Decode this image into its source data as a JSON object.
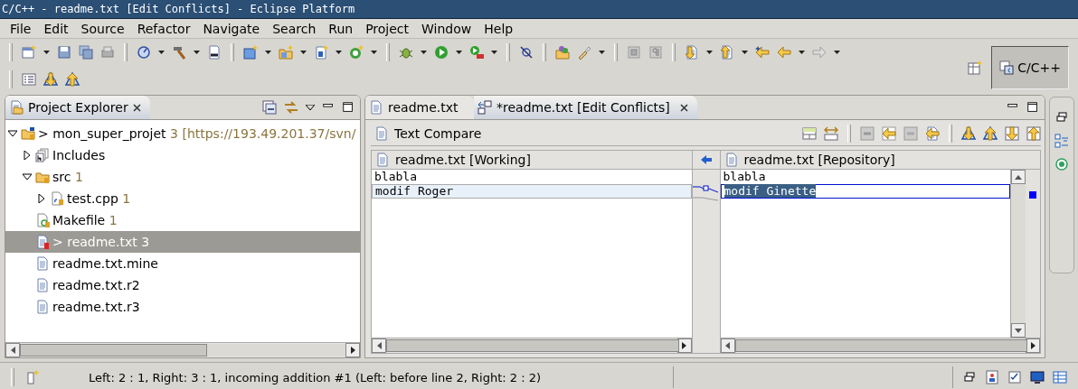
{
  "window": {
    "title": "C/C++ - readme.txt [Edit Conflicts] - Eclipse Platform"
  },
  "menu": [
    {
      "label": "File"
    },
    {
      "label": "Edit"
    },
    {
      "label": "Source"
    },
    {
      "label": "Refactor"
    },
    {
      "label": "Navigate"
    },
    {
      "label": "Search"
    },
    {
      "label": "Run"
    },
    {
      "label": "Project"
    },
    {
      "label": "Window"
    },
    {
      "label": "Help"
    }
  ],
  "perspective": {
    "label": "C/C++",
    "selected": true
  },
  "explorer": {
    "title": "Project Explorer",
    "tree": [
      {
        "kind": "project",
        "prefix": ">",
        "name": "mon_super_projet",
        "count": "3",
        "location": "[https://193.49.201.37/svn/",
        "expanded": true,
        "selected": false,
        "children": [
          {
            "kind": "includes",
            "name": "Includes",
            "expanded": false,
            "selected": false
          },
          {
            "kind": "folder",
            "name": "src",
            "count": "1",
            "expanded": true,
            "selected": false,
            "children": [
              {
                "kind": "source",
                "name": "test.cpp",
                "count": "1",
                "expanded": false,
                "selected": false
              }
            ]
          },
          {
            "kind": "makefile",
            "name": "Makefile",
            "count": "1",
            "selected": false
          },
          {
            "kind": "conflict",
            "prefix": ">",
            "name": "readme.txt",
            "count": "3",
            "selected": true
          },
          {
            "kind": "text",
            "name": "readme.txt.mine",
            "selected": false
          },
          {
            "kind": "text",
            "name": "readme.txt.r2",
            "selected": false
          },
          {
            "kind": "text",
            "name": "readme.txt.r3",
            "selected": false
          }
        ]
      }
    ]
  },
  "editor": {
    "tabs": [
      {
        "label": "readme.txt",
        "selected": false
      },
      {
        "label": "*readme.txt [Edit Conflicts]",
        "selected": true
      }
    ],
    "compare_title": "Text Compare",
    "left": {
      "title": "readme.txt [Working]",
      "lines": [
        {
          "text": "blabla",
          "changed": false,
          "selected": false
        },
        {
          "text": "modif Roger",
          "changed": true,
          "selected": false
        }
      ]
    },
    "right": {
      "title": "readme.txt [Repository]",
      "lines": [
        {
          "text": "blabla",
          "changed": false,
          "selected": false
        },
        {
          "text": "modif Ginette",
          "changed": true,
          "selected": true
        }
      ]
    }
  },
  "status_bar": {
    "message": "Left: 2 : 1, Right: 3 : 1, incoming addition #1 (Left: before line 2, Right: 2 : 2)"
  }
}
